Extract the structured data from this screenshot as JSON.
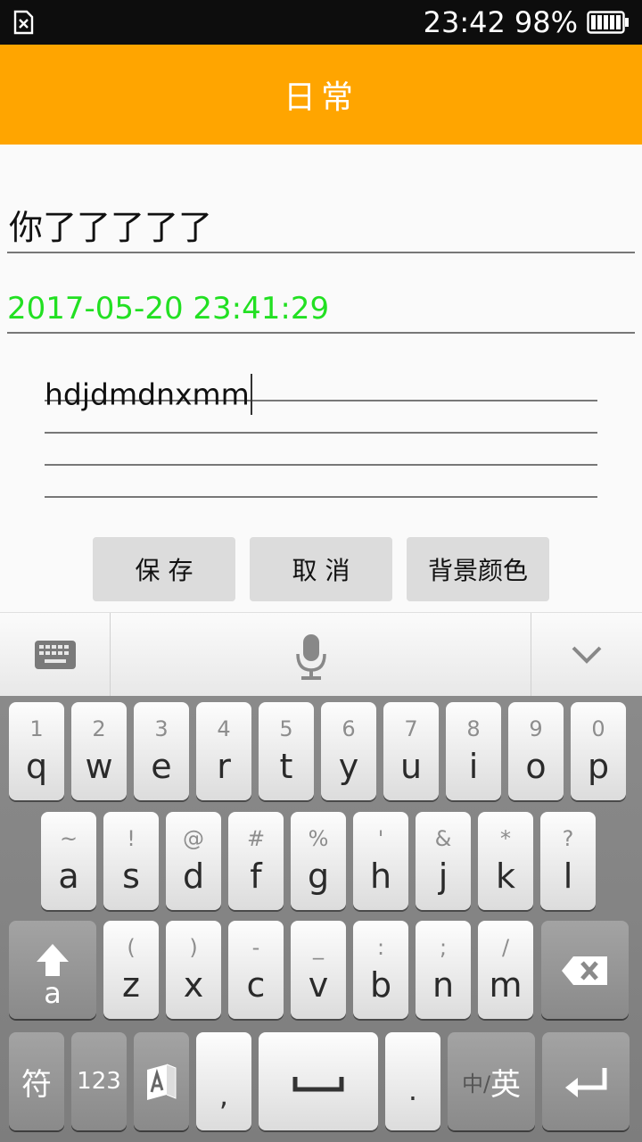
{
  "status_bar": {
    "time": "23:42",
    "battery": "98%"
  },
  "app_bar": {
    "title": "日常"
  },
  "note": {
    "title_value": "你了了了了了",
    "date_value": "2017-05-20 23:41:29",
    "content_value": "hdjdmdnxmm"
  },
  "buttons": {
    "save": "保 存",
    "cancel": "取 消",
    "bg_color": "背景颜色"
  },
  "keyboard": {
    "row1": [
      {
        "sub": "1",
        "main": "q"
      },
      {
        "sub": "2",
        "main": "w"
      },
      {
        "sub": "3",
        "main": "e"
      },
      {
        "sub": "4",
        "main": "r"
      },
      {
        "sub": "5",
        "main": "t"
      },
      {
        "sub": "6",
        "main": "y"
      },
      {
        "sub": "7",
        "main": "u"
      },
      {
        "sub": "8",
        "main": "i"
      },
      {
        "sub": "9",
        "main": "o"
      },
      {
        "sub": "0",
        "main": "p"
      }
    ],
    "row2": [
      {
        "sub": "~",
        "main": "a"
      },
      {
        "sub": "!",
        "main": "s"
      },
      {
        "sub": "@",
        "main": "d"
      },
      {
        "sub": "#",
        "main": "f"
      },
      {
        "sub": "%",
        "main": "g"
      },
      {
        "sub": "'",
        "main": "h"
      },
      {
        "sub": "&",
        "main": "j"
      },
      {
        "sub": "*",
        "main": "k"
      },
      {
        "sub": "?",
        "main": "l"
      }
    ],
    "row3": [
      {
        "sub": "(",
        "main": "z"
      },
      {
        "sub": ")",
        "main": "x"
      },
      {
        "sub": "-",
        "main": "c"
      },
      {
        "sub": "_",
        "main": "v"
      },
      {
        "sub": ":",
        "main": "b"
      },
      {
        "sub": ";",
        "main": "n"
      },
      {
        "sub": "/",
        "main": "m"
      }
    ],
    "shift_label": "a",
    "symbols_label": "符",
    "numbers_label": "123",
    "comma_label": ",",
    "period_label": ".",
    "lang_small": "中/",
    "lang_big": "英"
  }
}
